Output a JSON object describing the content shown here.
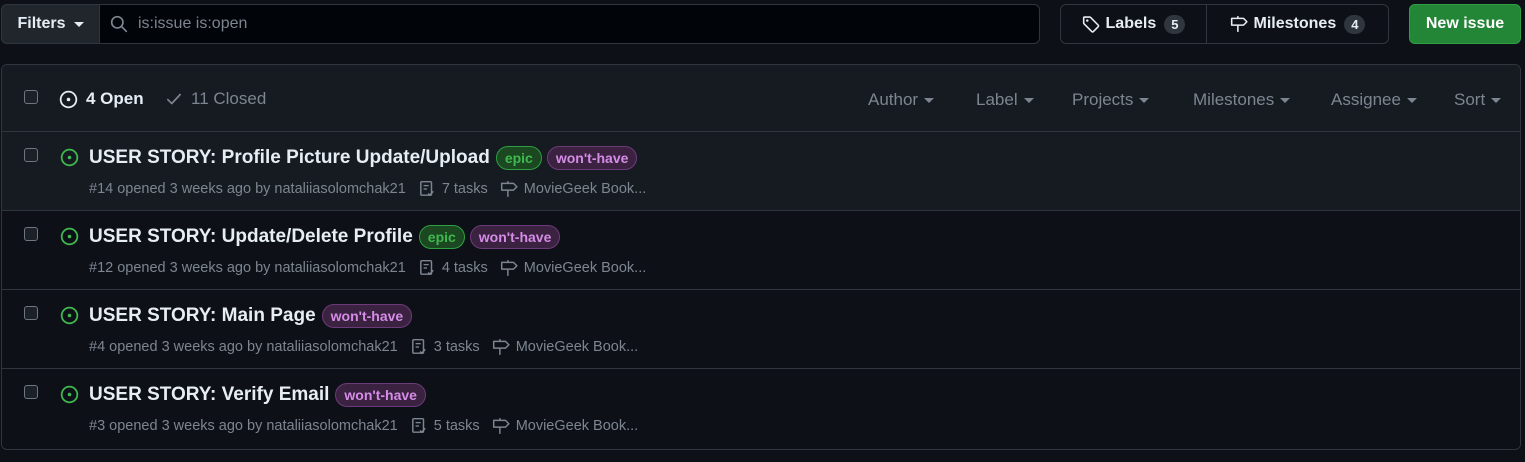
{
  "toolbar": {
    "filters_label": "Filters",
    "search_value": "is:issue is:open",
    "labels_label": "Labels",
    "labels_count": "5",
    "milestones_label": "Milestones",
    "milestones_count": "4",
    "new_issue_label": "New issue"
  },
  "list_header": {
    "open_label": "4 Open",
    "closed_label": "11 Closed",
    "filters": [
      "Author",
      "Label",
      "Projects",
      "Milestones",
      "Assignee",
      "Sort"
    ]
  },
  "issues": [
    {
      "title": "USER STORY: Profile Picture Update/Upload",
      "labels": [
        "epic",
        "won't-have"
      ],
      "meta": "#14 opened 3 weeks ago by nataliiasolomchak21",
      "tasks": "7 tasks",
      "milestone": "MovieGeek Book..."
    },
    {
      "title": "USER STORY: Update/Delete Profile",
      "labels": [
        "epic",
        "won't-have"
      ],
      "meta": "#12 opened 3 weeks ago by nataliiasolomchak21",
      "tasks": "4 tasks",
      "milestone": "MovieGeek Book..."
    },
    {
      "title": "USER STORY: Main Page",
      "labels": [
        "won't-have"
      ],
      "meta": "#4 opened 3 weeks ago by nataliiasolomchak21",
      "tasks": "3 tasks",
      "milestone": "MovieGeek Book..."
    },
    {
      "title": "USER STORY: Verify Email",
      "labels": [
        "won't-have"
      ],
      "meta": "#3 opened 3 weeks ago by nataliiasolomchak21",
      "tasks": "5 tasks",
      "milestone": "MovieGeek Book..."
    }
  ],
  "colors": {
    "open_green": "#3fb950",
    "primary_button": "#238636",
    "epic_label": "#3fb950",
    "wont_have_label": "#d58ce7"
  }
}
